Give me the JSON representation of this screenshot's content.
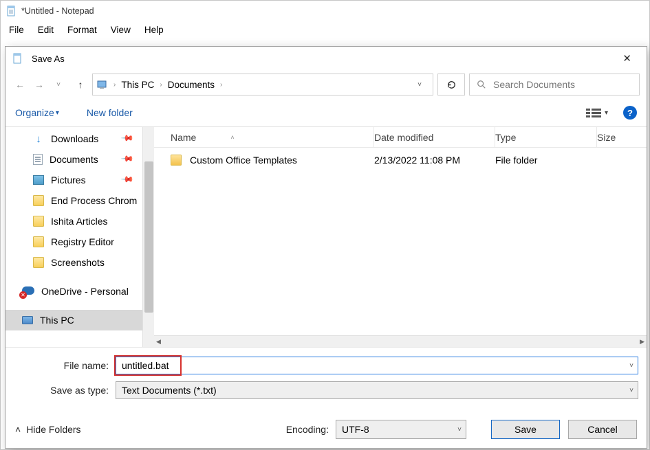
{
  "notepad": {
    "title": "*Untitled - Notepad",
    "menu": [
      "File",
      "Edit",
      "Format",
      "View",
      "Help"
    ]
  },
  "dialog": {
    "title": "Save As",
    "breadcrumb": {
      "root": "This PC",
      "folder": "Documents"
    },
    "search_placeholder": "Search Documents",
    "toolbar": {
      "organize": "Organize",
      "newfolder": "New folder"
    },
    "sidebar": [
      {
        "label": "Downloads",
        "icon": "download",
        "pinned": true
      },
      {
        "label": "Documents",
        "icon": "document",
        "pinned": true
      },
      {
        "label": "Pictures",
        "icon": "pictures",
        "pinned": true
      },
      {
        "label": "End Process Chrom",
        "icon": "folder"
      },
      {
        "label": "Ishita Articles",
        "icon": "folder"
      },
      {
        "label": "Registry Editor",
        "icon": "folder"
      },
      {
        "label": "Screenshots",
        "icon": "folder"
      },
      {
        "label": "OneDrive - Personal",
        "icon": "onedrive",
        "level": 1
      },
      {
        "label": "This PC",
        "icon": "pc",
        "level": 1,
        "selected": true
      }
    ],
    "columns": {
      "name": "Name",
      "date": "Date modified",
      "type": "Type",
      "size": "Size"
    },
    "rows": [
      {
        "name": "Custom Office Templates",
        "date": "2/13/2022 11:08 PM",
        "type": "File folder"
      }
    ],
    "form": {
      "filename_label": "File name:",
      "filename_value": "untitled.bat",
      "savetype_label": "Save as type:",
      "savetype_value": "Text Documents (*.txt)"
    },
    "footer": {
      "hide_folders": "Hide Folders",
      "encoding_label": "Encoding:",
      "encoding_value": "UTF-8",
      "save": "Save",
      "cancel": "Cancel"
    }
  }
}
